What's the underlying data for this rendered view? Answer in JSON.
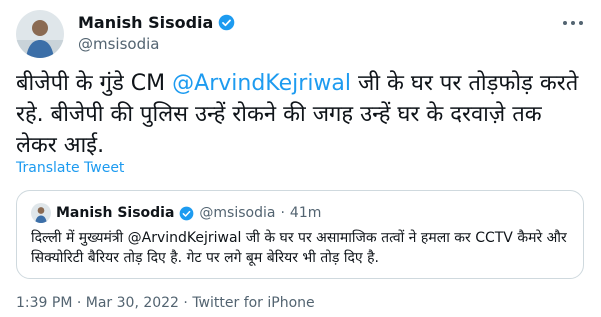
{
  "author": {
    "name": "Manish Sisodia",
    "handle": "@msisodia",
    "avatar_icon": "profile-photo"
  },
  "tweet": {
    "text_before": "बीजेपी के गुंडे CM ",
    "mention": "@ArvindKejriwal",
    "text_after": " जी के घर पर तोड़फोड़ करते रहे. बीजेपी की पुलिस उन्हें रोकने की जगह उन्हें घर के दरवाज़े तक लेकर आई.",
    "translate_label": "Translate Tweet"
  },
  "quoted": {
    "name": "Manish Sisodia",
    "handle": "@msisodia",
    "separator": "·",
    "time": "41m",
    "text": "दिल्ली में मुख्यमंत्री @ArvindKejriwal जी के घर पर असामाजिक तत्वों ने हमला कर CCTV कैमरे और सिक्योरिटी बैरियर तोड़ दिए है. गेट पर लगे बूम बेरियर भी तोड़ दिए है."
  },
  "footer": {
    "timestamp": "1:39 PM · Mar 30, 2022 · Twitter for iPhone"
  },
  "colors": {
    "accent": "#1d9bf0",
    "text": "#0f1419",
    "secondary": "#536471",
    "border": "#cfd9de"
  }
}
